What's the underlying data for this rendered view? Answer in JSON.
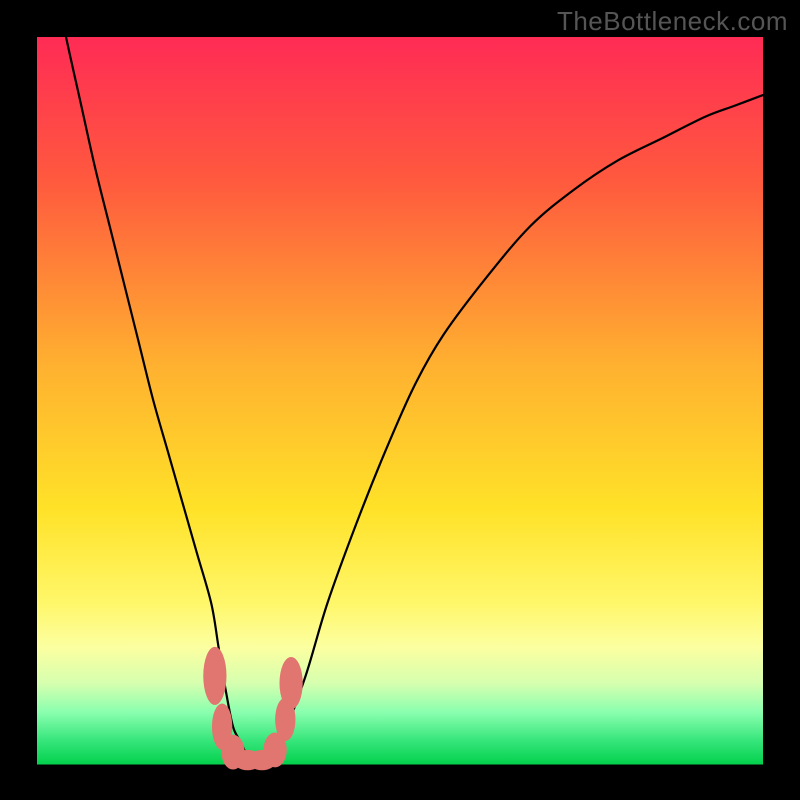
{
  "watermark": "TheBottleneck.com",
  "colors": {
    "frame_bg": "#000000",
    "watermark": "#555555",
    "curve": "#000000",
    "marker": "#e0766f",
    "baseline": "#06d24f"
  },
  "chart_data": {
    "type": "line",
    "title": "",
    "xlabel": "",
    "ylabel": "",
    "xlim": [
      0,
      100
    ],
    "ylim": [
      0,
      100
    ],
    "gradient_stops": [
      {
        "pct": 0,
        "color": "#ff2b55"
      },
      {
        "pct": 20,
        "color": "#ff5a3e"
      },
      {
        "pct": 45,
        "color": "#ffb030"
      },
      {
        "pct": 65,
        "color": "#ffe228"
      },
      {
        "pct": 78,
        "color": "#fff76a"
      },
      {
        "pct": 84,
        "color": "#fcffa0"
      },
      {
        "pct": 89,
        "color": "#d6ffaf"
      },
      {
        "pct": 93,
        "color": "#8affaf"
      },
      {
        "pct": 97,
        "color": "#35e57a"
      },
      {
        "pct": 100,
        "color": "#06d24f"
      }
    ],
    "series": [
      {
        "name": "bottleneck-curve",
        "x": [
          0,
          2,
          4,
          6,
          8,
          10,
          12,
          14,
          16,
          18,
          20,
          22,
          24,
          25,
          26,
          27,
          28,
          29,
          30,
          32,
          34,
          37,
          40,
          44,
          48,
          52,
          56,
          62,
          68,
          74,
          80,
          86,
          92,
          96,
          100
        ],
        "y": [
          120,
          110,
          100,
          91,
          82,
          74,
          66,
          58,
          50,
          43,
          36,
          29,
          22,
          16,
          10,
          5,
          3,
          1,
          0.3,
          0.3,
          4,
          12,
          22,
          33,
          43,
          52,
          59,
          67,
          74,
          79,
          83,
          86,
          89,
          90.5,
          92
        ]
      }
    ],
    "markers": [
      {
        "x": 24.5,
        "y": 12,
        "rx": 1.6,
        "ry": 4
      },
      {
        "x": 25.5,
        "y": 5,
        "rx": 1.4,
        "ry": 3.2
      },
      {
        "x": 27.0,
        "y": 1.5,
        "rx": 1.6,
        "ry": 2.4
      },
      {
        "x": 29.0,
        "y": 0.4,
        "rx": 2.0,
        "ry": 1.4
      },
      {
        "x": 31.0,
        "y": 0.4,
        "rx": 2.0,
        "ry": 1.4
      },
      {
        "x": 32.8,
        "y": 1.8,
        "rx": 1.6,
        "ry": 2.4
      },
      {
        "x": 34.2,
        "y": 6,
        "rx": 1.4,
        "ry": 3.0
      },
      {
        "x": 35.0,
        "y": 11,
        "rx": 1.6,
        "ry": 3.6
      }
    ],
    "baseline_y": 0
  }
}
